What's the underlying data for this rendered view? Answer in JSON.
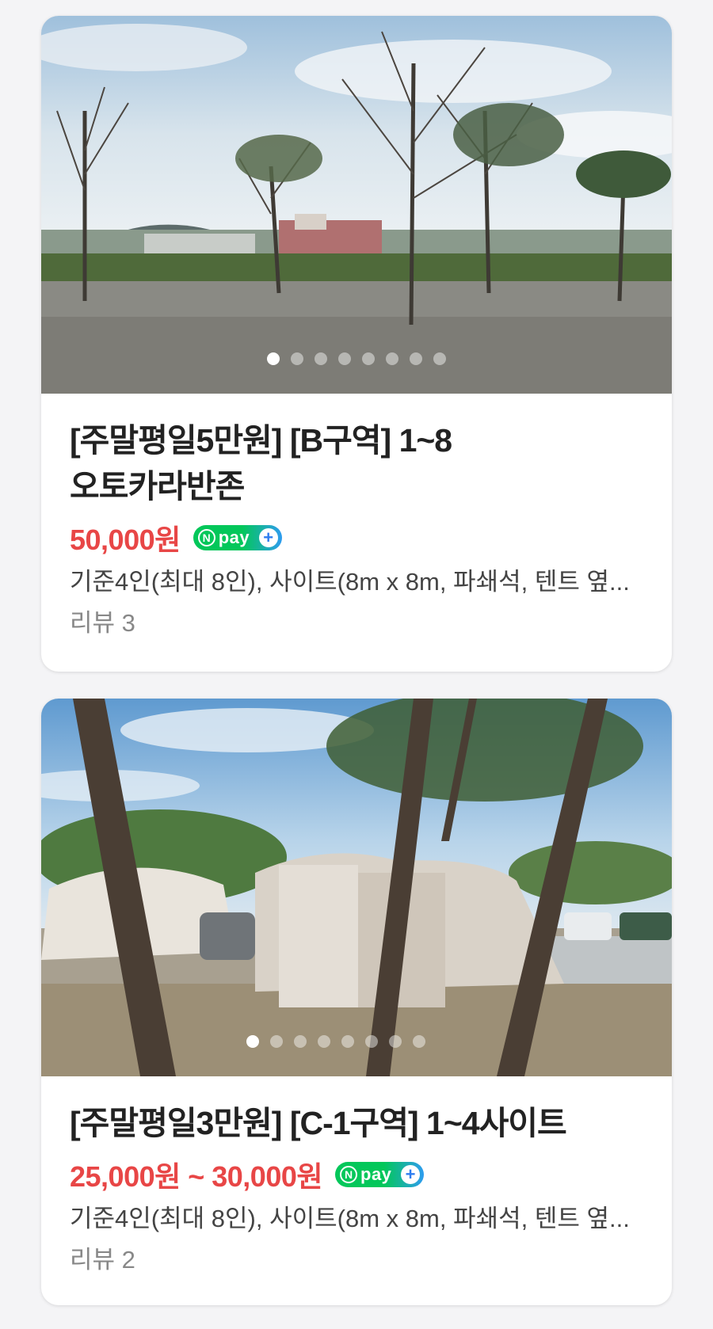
{
  "listings": [
    {
      "title_line1": "[주말평일5만원] [B구역] 1~8",
      "title_line2": "오토카라반존",
      "price": "50,000원",
      "pay_badge": "pay",
      "description": "기준4인(최대 8인), 사이트(8m x 8m, 파쇄석, 텐트 옆...",
      "review": "리뷰 3",
      "image_count": 8,
      "active_image": 1
    },
    {
      "title_line1": "[주말평일3만원] [C-1구역] 1~4사이트",
      "price": "25,000원 ~ 30,000원",
      "pay_badge": "pay",
      "description": "기준4인(최대 8인), 사이트(8m x 8m, 파쇄석, 텐트 옆...",
      "review": "리뷰 2",
      "image_count": 8,
      "active_image": 1
    }
  ],
  "colors": {
    "price": "#e84646",
    "npay_green": "#03c75a",
    "npay_blue": "#2e9cf0"
  }
}
